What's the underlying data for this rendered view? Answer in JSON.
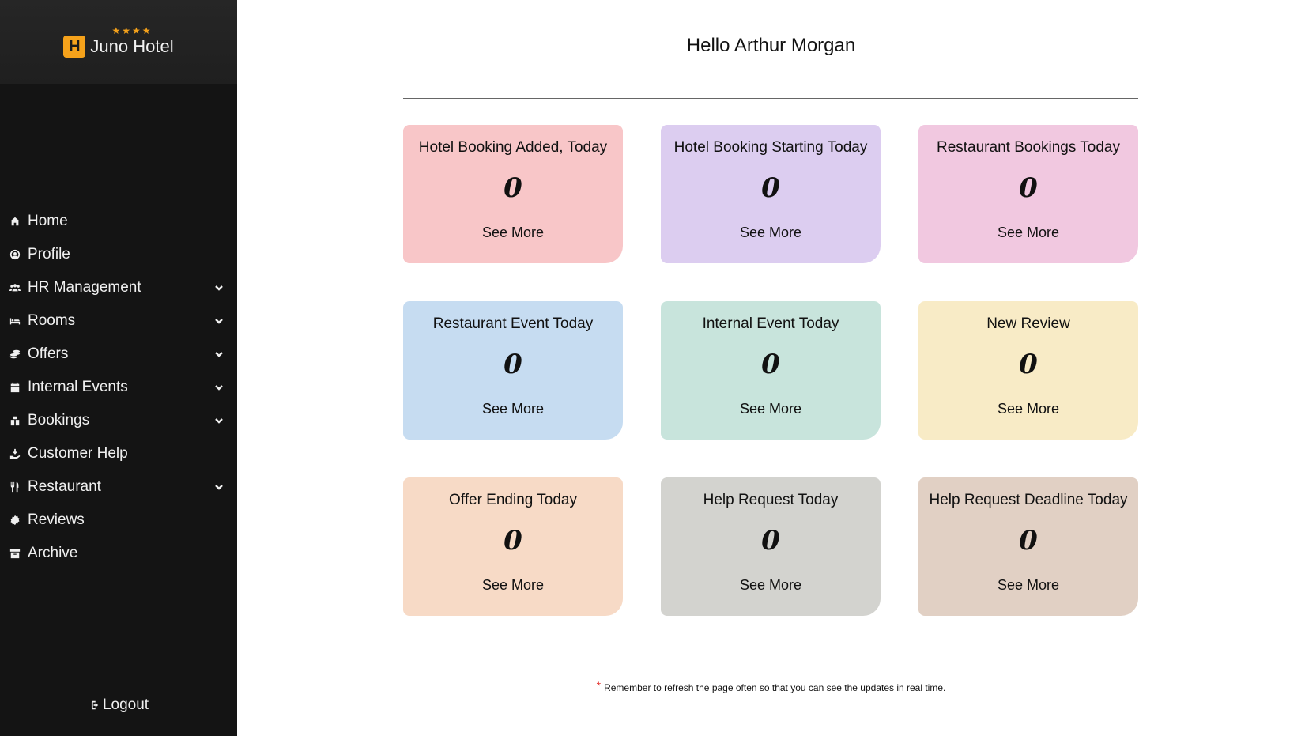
{
  "brand": {
    "name": "Juno Hotel",
    "logo_letter": "H",
    "stars": "★★★★",
    "accent": "#f5a21b"
  },
  "sidebar": {
    "items": [
      {
        "label": "Home",
        "icon": "home-icon",
        "expandable": false
      },
      {
        "label": "Profile",
        "icon": "user-circle-icon",
        "expandable": false
      },
      {
        "label": "HR Management",
        "icon": "users-icon",
        "expandable": true
      },
      {
        "label": "Rooms",
        "icon": "bed-icon",
        "expandable": true
      },
      {
        "label": "Offers",
        "icon": "coins-icon",
        "expandable": true
      },
      {
        "label": "Internal Events",
        "icon": "calendar-icon",
        "expandable": true
      },
      {
        "label": "Bookings",
        "icon": "bookings-icon",
        "expandable": true
      },
      {
        "label": "Customer Help",
        "icon": "hand-help-icon",
        "expandable": false
      },
      {
        "label": "Restaurant",
        "icon": "utensils-icon",
        "expandable": true
      },
      {
        "label": "Reviews",
        "icon": "badge-icon",
        "expandable": false
      },
      {
        "label": "Archive",
        "icon": "archive-icon",
        "expandable": false
      }
    ],
    "logout_label": "Logout"
  },
  "main": {
    "greeting": "Hello Arthur Morgan",
    "cards": [
      {
        "title": "Hotel Booking Added, Today",
        "value": "0",
        "link": "See More",
        "color": "#f8c6c8"
      },
      {
        "title": "Hotel Booking Starting Today",
        "value": "0",
        "link": "See More",
        "color": "#dccdf0"
      },
      {
        "title": "Restaurant Bookings Today",
        "value": "0",
        "link": "See More",
        "color": "#f1c8e0"
      },
      {
        "title": "Restaurant Event Today",
        "value": "0",
        "link": "See More",
        "color": "#c6dcf1"
      },
      {
        "title": "Internal Event Today",
        "value": "0",
        "link": "See More",
        "color": "#c8e4dc"
      },
      {
        "title": "New Review",
        "value": "0",
        "link": "See More",
        "color": "#f8ebc6"
      },
      {
        "title": "Offer Ending Today",
        "value": "0",
        "link": "See More",
        "color": "#f7dac6"
      },
      {
        "title": "Help Request Today",
        "value": "0",
        "link": "See More",
        "color": "#d3d3cf"
      },
      {
        "title": "Help Request Deadline Today",
        "value": "0",
        "link": "See More",
        "color": "#e1d0c4"
      }
    ],
    "note": "Remember to refresh the page often so that you can see the updates in real time."
  }
}
